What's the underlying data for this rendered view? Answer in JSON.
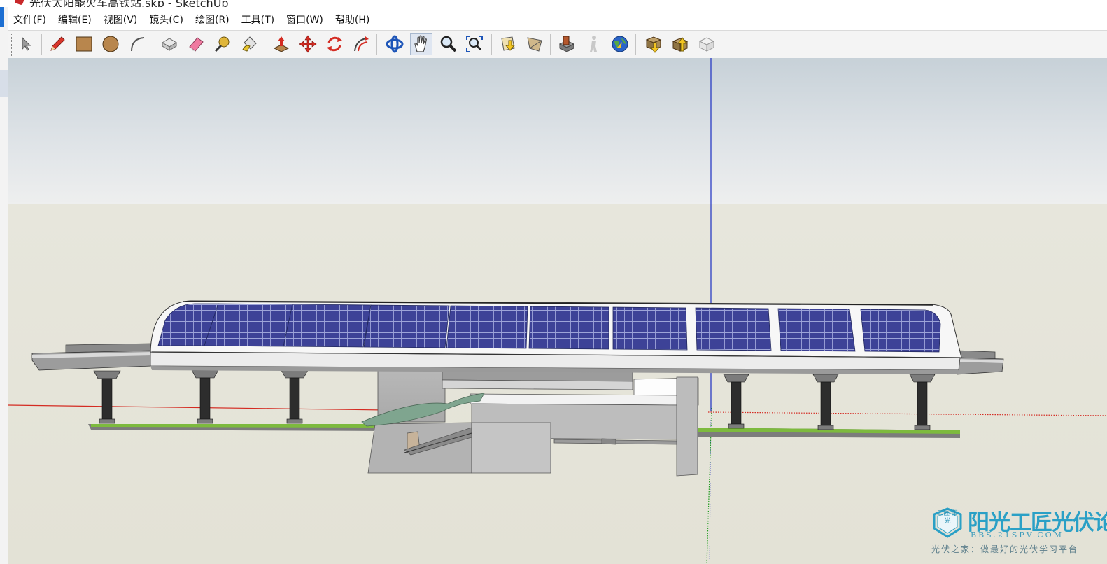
{
  "window": {
    "title": "光伏太阳能火车高铁站.skp - SketchUp"
  },
  "menu": [
    {
      "id": "file",
      "label": "文件(F)"
    },
    {
      "id": "edit",
      "label": "编辑(E)"
    },
    {
      "id": "view",
      "label": "视图(V)"
    },
    {
      "id": "camera",
      "label": "镜头(C)"
    },
    {
      "id": "draw",
      "label": "绘图(R)"
    },
    {
      "id": "tools",
      "label": "工具(T)"
    },
    {
      "id": "window",
      "label": "窗口(W)"
    },
    {
      "id": "help",
      "label": "帮助(H)"
    }
  ],
  "toolbar": {
    "active_tool": "pan",
    "tools": [
      "select",
      "pencil",
      "rectangle",
      "circle",
      "arc",
      "make-component",
      "eraser",
      "tape-measure",
      "paint-bucket",
      "push-pull",
      "move",
      "rotate",
      "follow-me",
      "orbit",
      "pan",
      "zoom",
      "zoom-extents",
      "previous-view",
      "next-view",
      "get-models",
      "share-model",
      "google-earth",
      "get-current-view",
      "toggle-terrain",
      "place-model"
    ]
  },
  "viewport": {
    "scene": "solar-powered railway station model",
    "axis_colors": {
      "red": "#d42b22",
      "green": "#1e9a1e",
      "blue": "#1c2fc2"
    },
    "panel_color": "#3b3f95"
  },
  "watermark": {
    "badge": "工匠 阳光",
    "title": "阳光工匠光伏论坛",
    "url": "BBS.21SPV.COM",
    "slogan": "光伏之家：做最好的光伏学习平台"
  }
}
